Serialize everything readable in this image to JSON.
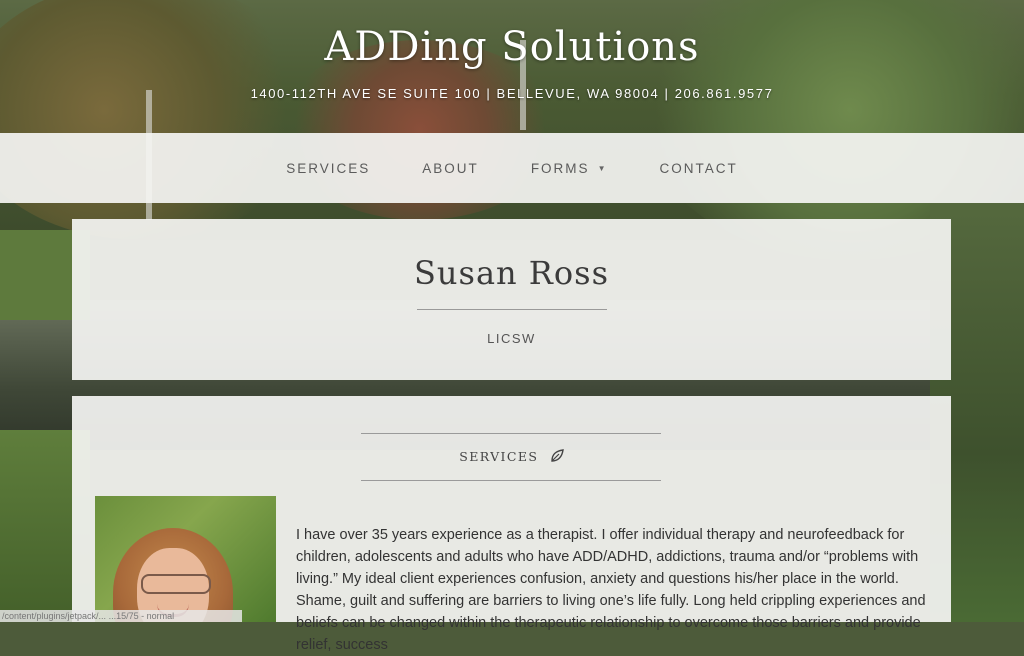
{
  "site": {
    "title": "ADDing Solutions",
    "address": "1400-112TH AVE SE SUITE 100 | BELLEVUE, WA 98004 | 206.861.9577"
  },
  "nav": {
    "items": [
      {
        "label": "SERVICES"
      },
      {
        "label": "ABOUT"
      },
      {
        "label": "FORMS",
        "has_dropdown": true
      },
      {
        "label": "CONTACT"
      }
    ]
  },
  "profile": {
    "name": "Susan Ross",
    "credential": "LICSW"
  },
  "services": {
    "heading": "SERVICES",
    "icon": "leaf-icon",
    "paragraph": "I have over 35 years experience as a therapist. I offer individual therapy and neurofeedback for children, adolescents and adults who have ADD/ADHD, addictions, trauma and/or “problems with living.” My ideal client experiences confusion, anxiety and questions his/her place in the world. Shame, guilt and suffering are barriers to living one’s life fully. Long held crippling experiences and beliefs can be changed within the therapeutic relationship to overcome those barriers and provide relief, success"
  },
  "status_bar": {
    "text": "/content/plugins/jetpack/...    ...15/75 - normal"
  },
  "colors": {
    "panel_bg": "#f5f5f3",
    "text_dark": "#3b3b3b",
    "nav_text": "#5b5b5b"
  }
}
